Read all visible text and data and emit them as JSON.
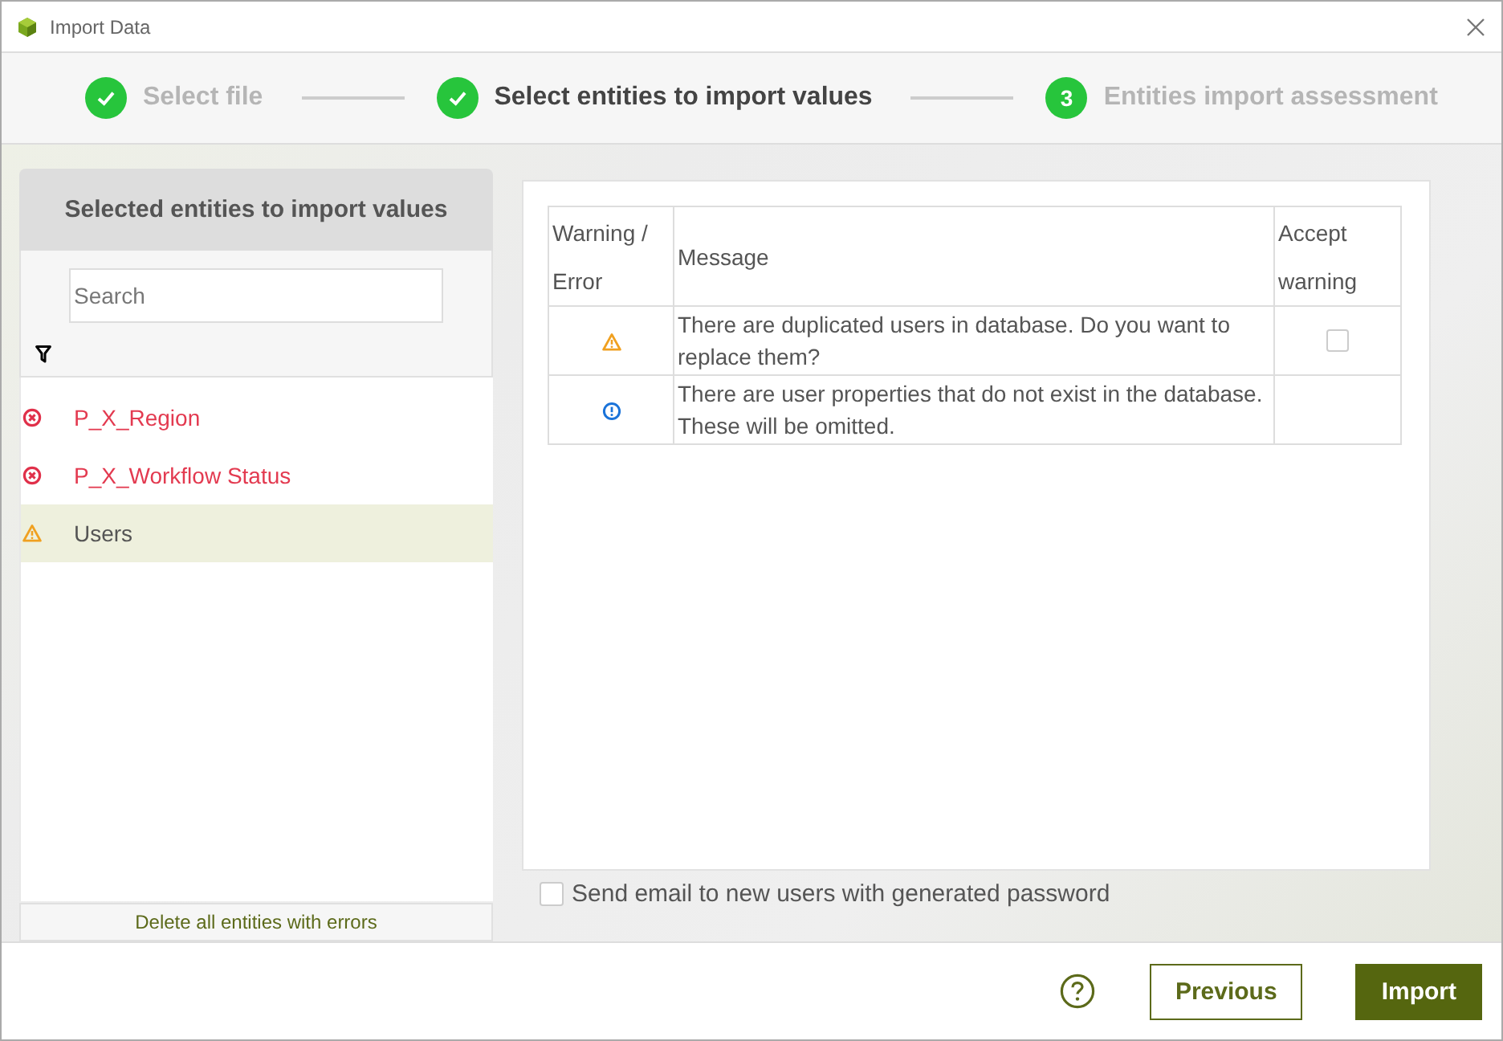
{
  "window": {
    "title": "Import Data"
  },
  "steps": [
    {
      "label": "Select file",
      "completed": true,
      "selected": false
    },
    {
      "label": "Select entities to import values",
      "completed": true,
      "selected": true
    },
    {
      "label": "Entities import assessment",
      "completed": false,
      "selected": false,
      "number": "3"
    }
  ],
  "entities_panel": {
    "title": "Selected entities to import values",
    "search": {
      "placeholder": "Search"
    },
    "items": [
      {
        "label": "P_X_Region",
        "kind": "error",
        "selected": false
      },
      {
        "label": "P_X_Workflow Status",
        "kind": "error",
        "selected": false
      },
      {
        "label": "Users",
        "kind": "warning",
        "selected": true
      }
    ],
    "delete_button": "Delete all entities with errors"
  },
  "table": {
    "columns": [
      "Warning / Error",
      "Message",
      "Accept warning"
    ],
    "rows": [
      {
        "kind": "warning",
        "message": "There are duplicated users in database. Do you want to replace them?",
        "checked": false
      },
      {
        "kind": "info",
        "message": "There are user properties that do not exist in the database. These will be omitted."
      }
    ]
  },
  "send_email": {
    "label": "Send email to new users with generated password",
    "checked": false
  },
  "footer": {
    "buttons": [
      {
        "label": "Previous",
        "kind": "secondary"
      },
      {
        "label": "Import",
        "kind": "primary"
      }
    ]
  }
}
